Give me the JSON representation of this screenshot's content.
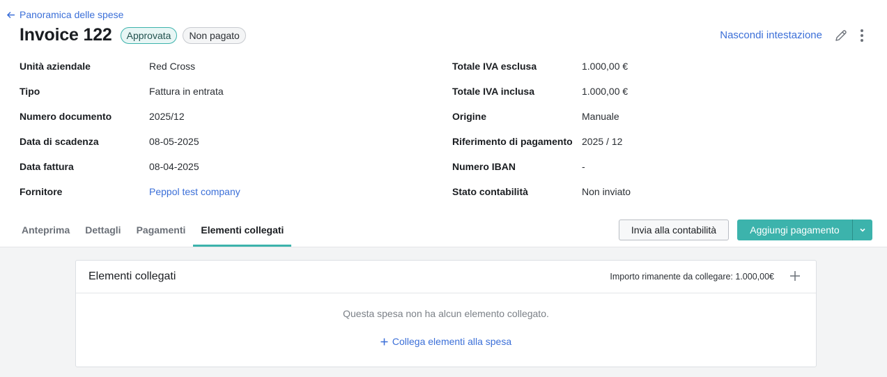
{
  "back_link": {
    "label": "Panoramica delle spese",
    "icon": "arrow-left-icon"
  },
  "title": "Invoice 122",
  "badges": {
    "approved": "Approvata",
    "unpaid": "Non pagato"
  },
  "header_actions": {
    "hide_header": "Nascondi intestazione",
    "edit_icon": "pencil-icon",
    "more_icon": "kebab-icon"
  },
  "fields_left": [
    {
      "label": "Unità aziendale",
      "value": "Red Cross"
    },
    {
      "label": "Tipo",
      "value": "Fattura in entrata"
    },
    {
      "label": "Numero documento",
      "value": "2025/12"
    },
    {
      "label": "Data di scadenza",
      "value": "08-05-2025"
    },
    {
      "label": "Data fattura",
      "value": "08-04-2025"
    },
    {
      "label": "Fornitore",
      "value": "Peppol test company"
    }
  ],
  "fields_right": [
    {
      "label": "Totale IVA esclusa",
      "value": "1.000,00 €"
    },
    {
      "label": "Totale IVA inclusa",
      "value": "1.000,00 €"
    },
    {
      "label": "Origine",
      "value": "Manuale"
    },
    {
      "label": "Riferimento di pagamento",
      "value": "2025 / 12"
    },
    {
      "label": "Numero IBAN",
      "value": "-"
    },
    {
      "label": "Stato contabilità",
      "value": "Non inviato"
    }
  ],
  "tabs": [
    {
      "label": "Anteprima"
    },
    {
      "label": "Dettagli"
    },
    {
      "label": "Pagamenti"
    },
    {
      "label": "Elementi collegati",
      "active": true
    }
  ],
  "actions": {
    "send_accounting": "Invia alla contabilità",
    "add_payment": "Aggiungi pagamento"
  },
  "linked_card": {
    "title": "Elementi collegati",
    "remaining": "Importo rimanente da collegare: 1.000,00€",
    "empty_text": "Questa spesa non ha alcun elemento collegato.",
    "link_action": "Collega elementi alla spesa"
  },
  "colors": {
    "accent": "#3cb3ac",
    "link": "#3b6fd8"
  }
}
